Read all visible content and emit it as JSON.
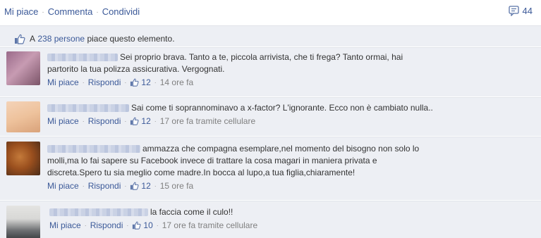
{
  "actions": {
    "like": "Mi piace",
    "comment": "Commenta",
    "share": "Condividi",
    "comment_count": "44",
    "separator": "·"
  },
  "likes_summary": {
    "prefix": "A",
    "people": "238 persone",
    "suffix": "piace questo elemento."
  },
  "comments": [
    {
      "text_line1": "Sei proprio brava. Tanto a te, piccola arrivista, che ti frega? Tanto ormai, hai",
      "text_line2": "partorito la tua polizza assicurativa. Vergognati.",
      "like": "Mi piace",
      "reply": "Rispondi",
      "likes": "12",
      "time": "14 ore fa"
    },
    {
      "text_line1": "Sai come ti soprannominavo a x-factor? L'ignorante. Ecco non è cambiato nulla..",
      "like": "Mi piace",
      "reply": "Rispondi",
      "likes": "12",
      "time": "17 ore fa tramite cellulare"
    },
    {
      "text_line1": "ammazza che compagna esemplare,nel momento del bisogno non solo lo",
      "text_line2": "molli,ma lo fai sapere su Facebook invece di trattare la cosa magari in maniera privata e",
      "text_line3": "discreta.Spero tu sia meglio come madre.In bocca al lupo,a tua figlia,chiaramente!",
      "like": "Mi piace",
      "reply": "Rispondi",
      "likes": "12",
      "time": "15 ore fa"
    },
    {
      "text_line1": "la faccia come il culo!!",
      "like": "Mi piace",
      "reply": "Rispondi",
      "likes": "10",
      "time": "17 ore fa tramite cellulare"
    }
  ],
  "colors": {
    "link": "#3b5998",
    "panel_bg": "#edeff4",
    "meta_gray": "#808080"
  }
}
